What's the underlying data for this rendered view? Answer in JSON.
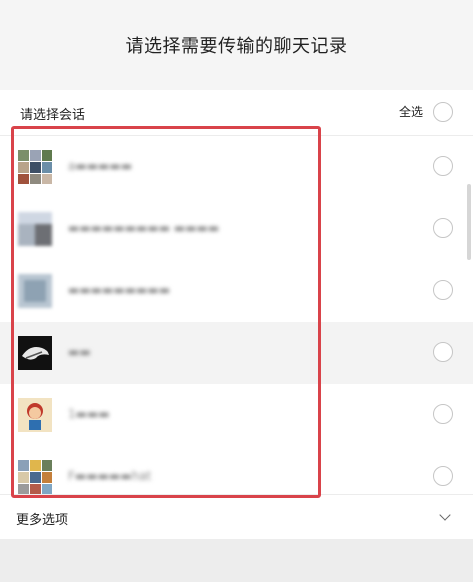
{
  "header": {
    "title": "请选择需要传输的聊天记录"
  },
  "select": {
    "label": "请选择会话",
    "all_label": "全选"
  },
  "conversations": [
    {
      "name": "a▬▬▬▬▬"
    },
    {
      "name": "▬▬▬▬▬▬▬▬▬ ▬▬▬▬"
    },
    {
      "name": "▬▬▬▬▬▬▬▬▬"
    },
    {
      "name": "▬▬"
    },
    {
      "name": "1▬▬▬"
    },
    {
      "name": "F▬▬▬▬▬hat"
    }
  ],
  "more": {
    "label": "更多选项"
  },
  "colors": {
    "highlight_box": "#d9434a",
    "header_bg": "#f5f5f5"
  }
}
